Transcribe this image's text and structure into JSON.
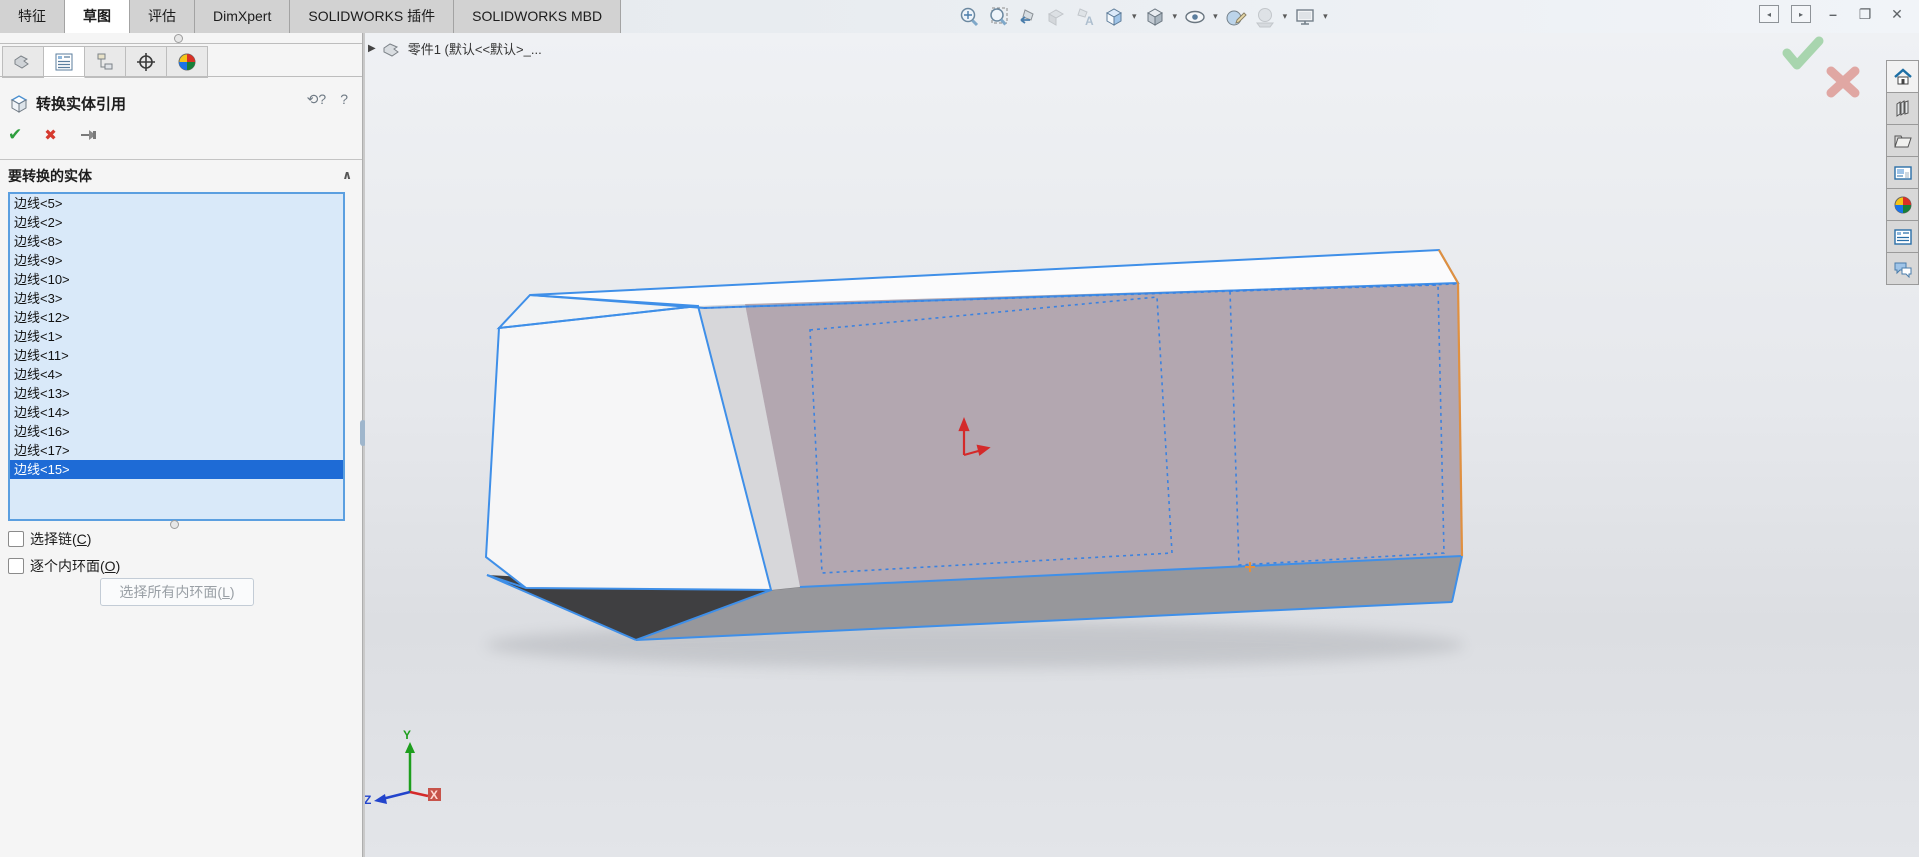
{
  "topbar": {
    "tabs": [
      {
        "label": "特征",
        "active": false
      },
      {
        "label": "草图",
        "active": true
      },
      {
        "label": "评估",
        "active": false
      },
      {
        "label": "DimXpert",
        "active": false
      },
      {
        "label": "SOLIDWORKS 插件",
        "active": false
      },
      {
        "label": "SOLIDWORKS MBD",
        "active": false
      }
    ],
    "headsup_icons": [
      "zoom-to-fit",
      "zoom-to-area",
      "previous-view",
      "section-view",
      "annotation-view",
      "view-orientation",
      "display-style",
      "hide-show-items",
      "edit-appearance",
      "apply-scene",
      "view-settings"
    ],
    "window_controls": [
      "collapse-left-pane",
      "collapse-right-pane",
      "minimize",
      "restore",
      "close"
    ],
    "minimize_glyph": "–",
    "restore_glyph": "❐",
    "close_glyph": "✕",
    "caret_glyph": "▾"
  },
  "property_manager": {
    "manager_tabs": [
      "feature-manager",
      "property-manager",
      "configuration-manager",
      "dimxpert-manager",
      "display-manager"
    ],
    "title": "转换实体引用",
    "header_icons": {
      "undo": "⟲?",
      "help": "?"
    },
    "actions": {
      "ok": "✔",
      "cancel": "✖"
    },
    "group_header": "要转换的实体",
    "group_chevron": "∧",
    "entities": [
      {
        "label": "边线<5>",
        "selected": false
      },
      {
        "label": "边线<2>",
        "selected": false
      },
      {
        "label": "边线<8>",
        "selected": false
      },
      {
        "label": "边线<9>",
        "selected": false
      },
      {
        "label": "边线<10>",
        "selected": false
      },
      {
        "label": "边线<3>",
        "selected": false
      },
      {
        "label": "边线<12>",
        "selected": false
      },
      {
        "label": "边线<1>",
        "selected": false
      },
      {
        "label": "边线<11>",
        "selected": false
      },
      {
        "label": "边线<4>",
        "selected": false
      },
      {
        "label": "边线<13>",
        "selected": false
      },
      {
        "label": "边线<14>",
        "selected": false
      },
      {
        "label": "边线<16>",
        "selected": false
      },
      {
        "label": "边线<17>",
        "selected": false
      },
      {
        "label": "边线<15>",
        "selected": true
      }
    ],
    "checkbox_chain": {
      "pre": "选择链(",
      "key": "C",
      "post": ")",
      "checked": false
    },
    "checkbox_loops": {
      "pre": "逐个内环面(",
      "key": "O",
      "post": ")",
      "checked": false
    },
    "select_all_button": {
      "pre": "选择所有内环面(",
      "key": "L",
      "post": ")",
      "enabled": false
    }
  },
  "viewport": {
    "breadcrumb": {
      "expand_arrow": "▶",
      "document": "零件1  (默认<<默认>_..."
    },
    "triad_labels": {
      "x": "X",
      "y": "Y",
      "z": "Z"
    },
    "confirm_corner": [
      "confirm",
      "cancel"
    ]
  },
  "task_pane_icons": [
    "solidworks-resources",
    "design-library",
    "file-explorer",
    "view-palette",
    "appearances-scenes",
    "custom-properties",
    "solidworks-forum"
  ],
  "colors": {
    "selection_edge_blue": "#3f8fe8",
    "preview_dashed_blue": "#3b82e0",
    "converted_edge_orange": "#e09040",
    "selected_face_mauve": "#b3a7b0",
    "list_selection_blue": "#1e6bd6",
    "list_background_blue": "#d9e9f9",
    "ok_green": "#2e9e3e",
    "cancel_red": "#d63a2f",
    "confirm_corner_green": "#a8d5ae",
    "confirm_corner_red": "#e0a7a3",
    "axis_x_red": "#d42a2a",
    "axis_y_green": "#1d9e1d",
    "axis_z_blue": "#2244cc"
  }
}
